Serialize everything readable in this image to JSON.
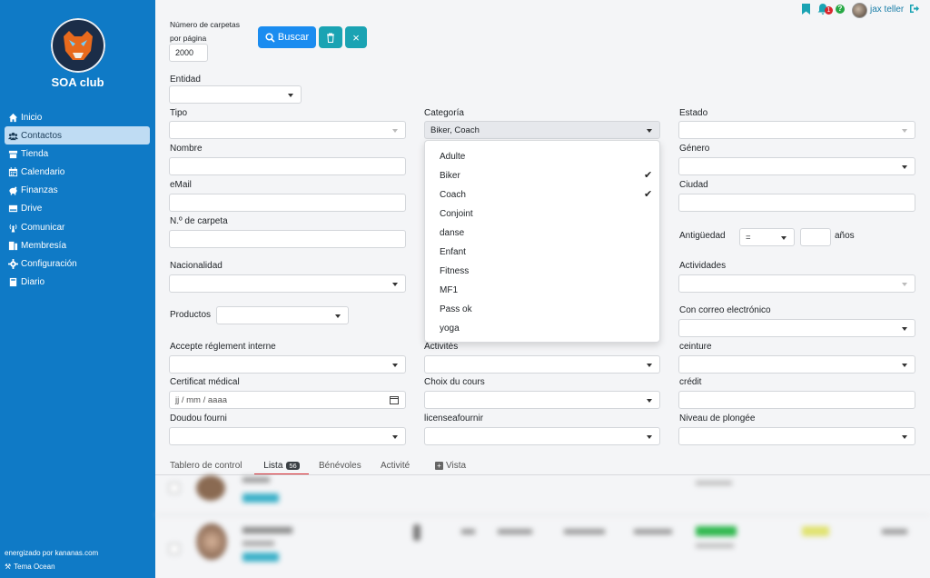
{
  "sidebar": {
    "club_name": "SOA club",
    "items": [
      {
        "label": "Inicio",
        "icon": "home-icon"
      },
      {
        "label": "Contactos",
        "icon": "users-icon"
      },
      {
        "label": "Tienda",
        "icon": "shop-icon"
      },
      {
        "label": "Calendario",
        "icon": "calendar-icon"
      },
      {
        "label": "Finanzas",
        "icon": "piggy-bank-icon"
      },
      {
        "label": "Drive",
        "icon": "drive-icon"
      },
      {
        "label": "Comunicar",
        "icon": "broadcast-icon"
      },
      {
        "label": "Membresía",
        "icon": "membership-icon"
      },
      {
        "label": "Configuración",
        "icon": "gear-icon"
      },
      {
        "label": "Diario",
        "icon": "book-icon"
      }
    ],
    "powered_by": "energizado por kananas.com",
    "theme": "Tema Ocean"
  },
  "topbar": {
    "notifications_count": "1",
    "help": "?",
    "user_name": "jax teller"
  },
  "filters": {
    "per_page_label_1": "Número de carpetas",
    "per_page_label_2": "por página",
    "per_page_value": "2000",
    "search_button": "Buscar",
    "entidad": "Entidad",
    "tipo": "Tipo",
    "categoria": "Categoría",
    "categoria_value": "Biker, Coach",
    "estado": "Estado",
    "nombre": "Nombre",
    "genero": "Género",
    "email": "eMail",
    "ciudad": "Ciudad",
    "carpeta": "N.º de carpeta",
    "antiguedad": "Antigüedad",
    "antiguedad_op": "=",
    "anos": "años",
    "nacionalidad": "Nacionalidad",
    "actividades": "Actividades",
    "productos": "Productos",
    "correo": "Con correo electrónico",
    "reglement": "Accepte réglement interne",
    "activites": "Activités",
    "ceinture": "ceinture",
    "certificat": "Certificat médical",
    "certificat_placeholder": "jj / mm / aaaa",
    "choix": "Choix du cours",
    "credit": "crédit",
    "doudou": "Doudou fourni",
    "license": "licenseafournir",
    "plongee": "Niveau de plongée"
  },
  "category_options": [
    {
      "label": "Adulte",
      "checked": false
    },
    {
      "label": "Biker",
      "checked": true
    },
    {
      "label": "Coach",
      "checked": true
    },
    {
      "label": "Conjoint",
      "checked": false
    },
    {
      "label": "danse",
      "checked": false
    },
    {
      "label": "Enfant",
      "checked": false
    },
    {
      "label": "Fitness",
      "checked": false
    },
    {
      "label": "MF1",
      "checked": false
    },
    {
      "label": "Pass ok",
      "checked": false
    },
    {
      "label": "yoga",
      "checked": false
    }
  ],
  "tabs": {
    "tablero": "Tablero de control",
    "lista": "Lista",
    "lista_count": "56",
    "benevoles": "Bénévoles",
    "activite": "Activité",
    "vista": "Vista"
  },
  "colors": {
    "sidebar": "#0f7ac6",
    "primary": "#1a8cf0",
    "teal": "#1aa3b3",
    "tab_underline": "#d9262e"
  }
}
